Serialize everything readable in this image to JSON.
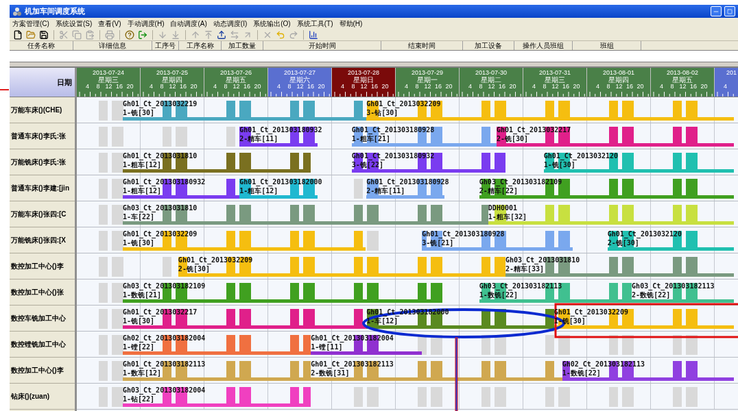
{
  "window": {
    "title": "机加车间调度系统"
  },
  "menu": [
    "方案管理(C)",
    "系统设置(S)",
    "查看(V)",
    "手动调度(H)",
    "自动调度(A)",
    "动态调度(I)",
    "系统输出(O)",
    "系统工具(T)",
    "帮助(H)"
  ],
  "toolbar": [
    {
      "disabled": false
    },
    {
      "disabled": false
    },
    {
      "disabled": false
    },
    {
      "disabled": true
    },
    {
      "disabled": true
    },
    {
      "disabled": true
    },
    {
      "disabled": true
    },
    {
      "disabled": false
    },
    {
      "disabled": false
    },
    {
      "disabled": true
    },
    {
      "disabled": true
    },
    {
      "disabled": true
    },
    {
      "disabled": true
    },
    {
      "disabled": false
    },
    {
      "disabled": true
    },
    {
      "disabled": true
    },
    {
      "disabled": true
    },
    {
      "disabled": false
    },
    {
      "disabled": true
    },
    {
      "disabled": false
    }
  ],
  "task_list": {
    "columns": [
      "任务名称",
      "详细信息",
      "工序号",
      "工序名称",
      "加工数量",
      "开始时间",
      "结束时间",
      "加工设备",
      "操作人员班组",
      "班组"
    ]
  },
  "gantt": {
    "corner": "日期",
    "days": [
      {
        "date": "2013-07-24",
        "weekday": "星期三",
        "kind": "workday",
        "hours": [
          "4",
          "8",
          "12",
          "16",
          "20"
        ]
      },
      {
        "date": "2013-07-25",
        "weekday": "星期四",
        "kind": "workday",
        "hours": [
          "4",
          "8",
          "12",
          "16",
          "20"
        ]
      },
      {
        "date": "2013-07-26",
        "weekday": "星期五",
        "kind": "workday",
        "hours": [
          "4",
          "8",
          "12",
          "16",
          "20"
        ]
      },
      {
        "date": "2013-07-27",
        "weekday": "星期六",
        "kind": "saturday",
        "hours": [
          "4",
          "8",
          "12",
          "16",
          "20"
        ]
      },
      {
        "date": "2013-07-28",
        "weekday": "星期日",
        "kind": "sunday",
        "hours": [
          "4",
          "8",
          "12",
          "16",
          "20"
        ]
      },
      {
        "date": "2013-07-29",
        "weekday": "星期一",
        "kind": "workday",
        "hours": [
          "4",
          "8",
          "12",
          "16",
          "20"
        ]
      },
      {
        "date": "2013-07-30",
        "weekday": "星期二",
        "kind": "workday",
        "hours": [
          "4",
          "8",
          "12",
          "16",
          "20"
        ]
      },
      {
        "date": "2013-07-31",
        "weekday": "星期三",
        "kind": "workday",
        "hours": [
          "4",
          "8",
          "12",
          "16",
          "20"
        ]
      },
      {
        "date": "2013-08-01",
        "weekday": "星期四",
        "kind": "workday",
        "hours": [
          "4",
          "8",
          "12",
          "16",
          "20"
        ]
      },
      {
        "date": "2013-08-02",
        "weekday": "星期五",
        "kind": "workday",
        "hours": [
          "4",
          "8",
          "12",
          "16",
          "20"
        ]
      },
      {
        "date": "201",
        "kind": "saturday",
        "hours": [
          "4"
        ]
      }
    ],
    "machines": [
      {
        "name": "万能车床()(CHE)",
        "tasks": [
          {
            "code": "Gh01_Ct_2013032219",
            "operation": "1-铣[30]",
            "color": "#4aa8c0"
          },
          {
            "code": "Gh01_Ct_2013032209",
            "operation": "3-钻[30]",
            "color": "#f5be10"
          }
        ]
      },
      {
        "name": "普通车床()李氏:张",
        "tasks": [
          {
            "code": "Gh01_Ct_201303180932",
            "operation": "2-精车[11]",
            "color": "#7a3cf0"
          },
          {
            "code": "Gh01_Ct_201303180928",
            "operation": "1-粗车[21]",
            "color": "#7aa8ee"
          },
          {
            "code": "Gh01_Ct_2013032217",
            "operation": "2-铣[30]",
            "color": "#e0208a"
          }
        ]
      },
      {
        "name": "万能铣床()李氏:张",
        "tasks": [
          {
            "code": "Gh01_Ct_2013031810",
            "operation": "1-粗车[12]",
            "color": "#7a7020"
          },
          {
            "code": "Gh01_Ct_201303180932",
            "operation": "3-铣[22]",
            "color": "#7a3cf0"
          },
          {
            "code": "Gh01_Ct_2013032120",
            "operation": "1-铣[30]",
            "color": "#20c0b0"
          }
        ]
      },
      {
        "name": "普通车床()李建:[jin",
        "tasks": [
          {
            "code": "Gh01_Ct_201303180932",
            "operation": "1-粗车[12]",
            "color": "#7a3cf0"
          },
          {
            "code": "Gh01_Ct_201303182000",
            "operation": "1-粗车[12]",
            "color": "#20b8d0"
          },
          {
            "code": "Gh01_Ct_201303180928",
            "operation": "2-精车[11]",
            "color": "#7aa8ee"
          },
          {
            "code": "Gh03_Ct_201303182109",
            "operation": "2-精车[22]",
            "color": "#40a020"
          }
        ]
      },
      {
        "name": "万能车床()张四:[C",
        "tasks": [
          {
            "code": "Gh03_Ct_2013031810",
            "operation": "1-车[22]",
            "color": "#7a9a80"
          },
          {
            "code": "DDH0001",
            "operation": "1-粗车[32]",
            "color": "#c8e040"
          }
        ]
      },
      {
        "name": "万能铣床()张四:[X",
        "tasks": [
          {
            "code": "Gh01_Ct_2013032209",
            "operation": "1-铣[30]",
            "color": "#f5be10"
          },
          {
            "code": "Gh01_Ct_201303180928",
            "operation": "3-铣[21]",
            "color": "#7aa8ee"
          },
          {
            "code": "Gh01_Ct_2013032120",
            "operation": "2-铣[30]",
            "color": "#20c0b0"
          }
        ]
      },
      {
        "name": "数控加工中心()李",
        "tasks": [
          {
            "code": "Gh01_Ct_2013032209",
            "operation": "2-铣[30]",
            "color": "#f5be10"
          },
          {
            "code": "Gh03_Ct_2013031810",
            "operation": "2-精车[33]",
            "color": "#7a9a80"
          }
        ]
      },
      {
        "name": "数控加工中心()张",
        "tasks": [
          {
            "code": "Gh03_Ct_201303182109",
            "operation": "1-数铣[21]",
            "color": "#40a020"
          },
          {
            "code": "Gh03_Ct_201303182113",
            "operation": "1-数铣[22]",
            "color": "#40c090"
          },
          {
            "code": "Gh03_Ct_201303182113",
            "operation": "2-数铣[22]",
            "color": "#40c090"
          }
        ]
      },
      {
        "name": "数控车铣加工中心",
        "tasks": [
          {
            "code": "Gh01_Ct_2013032217",
            "operation": "1-铣[30]",
            "color": "#e0208a"
          },
          {
            "code": "Gh01_Ct_201303182000",
            "operation": "1-车[12]",
            "color": "#5a8a20"
          },
          {
            "code": "Gh01_Ct_2013032209",
            "operation": "1-铣[30]",
            "color": "#f5be10"
          }
        ]
      },
      {
        "name": "数控镗铣加工中心",
        "tasks": [
          {
            "code": "Gh02_Ct_201303182004",
            "operation": "1-镗[22]",
            "color": "#f07040"
          },
          {
            "code": "Gh01_Ct_201303182004",
            "operation": "1-镗[11]",
            "color": "#9030d0"
          }
        ]
      },
      {
        "name": "数控加工中心()李",
        "tasks": [
          {
            "code": "Gh01_Ct_201303182113",
            "operation": "1-数车[12]",
            "color": "#d0a850"
          },
          {
            "code": "Gh01_Ct_201303182113",
            "operation": "2-数铣[31]",
            "color": "#d0a850"
          },
          {
            "code": "Gh02_Ct_201303182113",
            "operation": "1-数铣[22]",
            "color": "#9040e0"
          }
        ]
      },
      {
        "name": "钻床()(zuan)",
        "tasks": [
          {
            "code": "Gh03_Ct_201303182004",
            "operation": "1-钻[22]",
            "color": "#f040c0"
          }
        ]
      }
    ]
  }
}
